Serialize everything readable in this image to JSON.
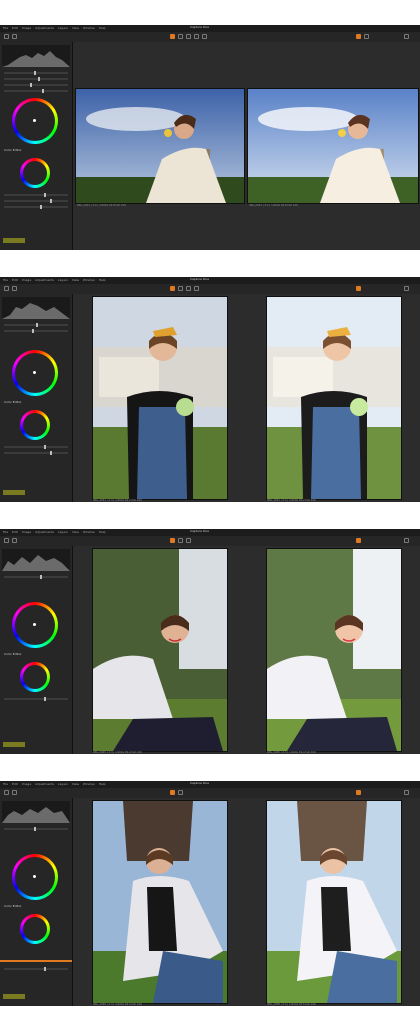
{
  "app": {
    "title": "Capture One"
  },
  "menu": [
    "File",
    "Edit",
    "Image",
    "Adjustments",
    "Layers",
    "Select",
    "View",
    "Window",
    "Help"
  ],
  "tabs": [
    "Before",
    "After"
  ],
  "panels": [
    {
      "id": "screen-1",
      "subject": "girl eating fruit",
      "captions": {
        "left": "IMG_2024 | 3:2 | 1/200s f/2.8 ISO 100",
        "right": "IMG_2024 | 3:2 | 1/200s f/2.8 ISO 100"
      }
    },
    {
      "id": "screen-2",
      "subject": "girl with lollipop",
      "captions": {
        "left": "IMG_2031 | 2:3 | 1/250s f/2.2 ISO 100",
        "right": "IMG_2031 | 2:3 | 1/250s f/2.2 ISO 100"
      }
    },
    {
      "id": "screen-3",
      "subject": "smiling girl sitting",
      "captions": {
        "left": "IMG_2045 | 2:3 | 1/160s f/2.0 ISO 100",
        "right": "IMG_2045 | 2:3 | 1/160s f/2.0 ISO 100"
      }
    },
    {
      "id": "screen-4",
      "subject": "girl in white jacket",
      "captions": {
        "left": "IMG_2058 | 2:3 | 1/320s f/2.5 ISO 100",
        "right": "IMG_2058 | 2:3 | 1/320s f/2.5 ISO 100"
      }
    }
  ],
  "sidebar": {
    "histogram_label": "Histogram",
    "exposure_label": "Exposure",
    "color_balance_label": "Color Balance",
    "color_editor_label": "Color Editor",
    "saturation_label": "Saturation"
  },
  "colors": {
    "accent": "#e07a20",
    "panel": "#262626",
    "workspace": "#2c2c2c",
    "chip": "#7a7a20"
  }
}
